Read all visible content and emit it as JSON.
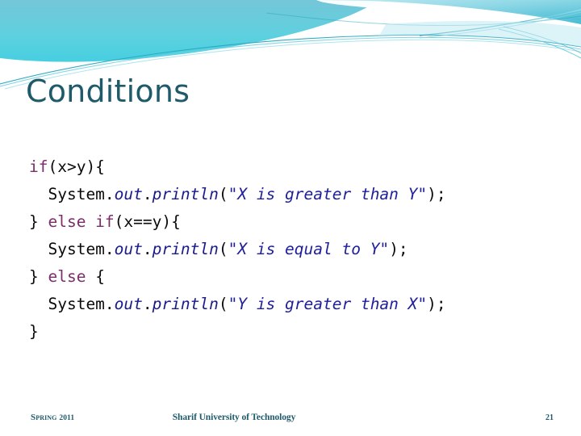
{
  "slide": {
    "title": "Conditions",
    "page_number": "21",
    "accent_color": "#1f5a6b",
    "wave_colors": [
      "#4fc8dc",
      "#7fd6e4",
      "#2aa8bf",
      "#1f8fa6",
      "#a9e3ee"
    ],
    "background_color": "#ffffff"
  },
  "code": {
    "language": "java",
    "lines": [
      {
        "indent": 0,
        "tokens": [
          {
            "text": "if",
            "kind": "keyword"
          },
          {
            "text": "(x>y){",
            "kind": "plain"
          }
        ]
      },
      {
        "indent": 1,
        "tokens": [
          {
            "text": "System.",
            "kind": "plain"
          },
          {
            "text": "out",
            "kind": "field"
          },
          {
            "text": ".",
            "kind": "plain"
          },
          {
            "text": "println",
            "kind": "field"
          },
          {
            "text": "(",
            "kind": "plain"
          },
          {
            "text": "\"X is greater than Y\"",
            "kind": "string"
          },
          {
            "text": ");",
            "kind": "plain"
          }
        ]
      },
      {
        "indent": 0,
        "tokens": [
          {
            "text": "} ",
            "kind": "plain"
          },
          {
            "text": "else if",
            "kind": "keyword"
          },
          {
            "text": "(x==y){",
            "kind": "plain"
          }
        ]
      },
      {
        "indent": 1,
        "tokens": [
          {
            "text": "System.",
            "kind": "plain"
          },
          {
            "text": "out",
            "kind": "field"
          },
          {
            "text": ".",
            "kind": "plain"
          },
          {
            "text": "println",
            "kind": "field"
          },
          {
            "text": "(",
            "kind": "plain"
          },
          {
            "text": "\"X is equal to Y\"",
            "kind": "string"
          },
          {
            "text": ");",
            "kind": "plain"
          }
        ]
      },
      {
        "indent": 0,
        "tokens": [
          {
            "text": "} ",
            "kind": "plain"
          },
          {
            "text": "else",
            "kind": "keyword"
          },
          {
            "text": " {",
            "kind": "plain"
          }
        ]
      },
      {
        "indent": 1,
        "tokens": [
          {
            "text": "System.",
            "kind": "plain"
          },
          {
            "text": "out",
            "kind": "field"
          },
          {
            "text": ".",
            "kind": "plain"
          },
          {
            "text": "println",
            "kind": "field"
          },
          {
            "text": "(",
            "kind": "plain"
          },
          {
            "text": "\"Y is greater than X\"",
            "kind": "string"
          },
          {
            "text": ");",
            "kind": "plain"
          }
        ]
      },
      {
        "indent": 0,
        "tokens": [
          {
            "text": "}",
            "kind": "plain"
          }
        ]
      }
    ]
  },
  "footer": {
    "season": "Spring ",
    "year": "2011",
    "organization": "Sharif University of Technology",
    "page_number": "21"
  }
}
